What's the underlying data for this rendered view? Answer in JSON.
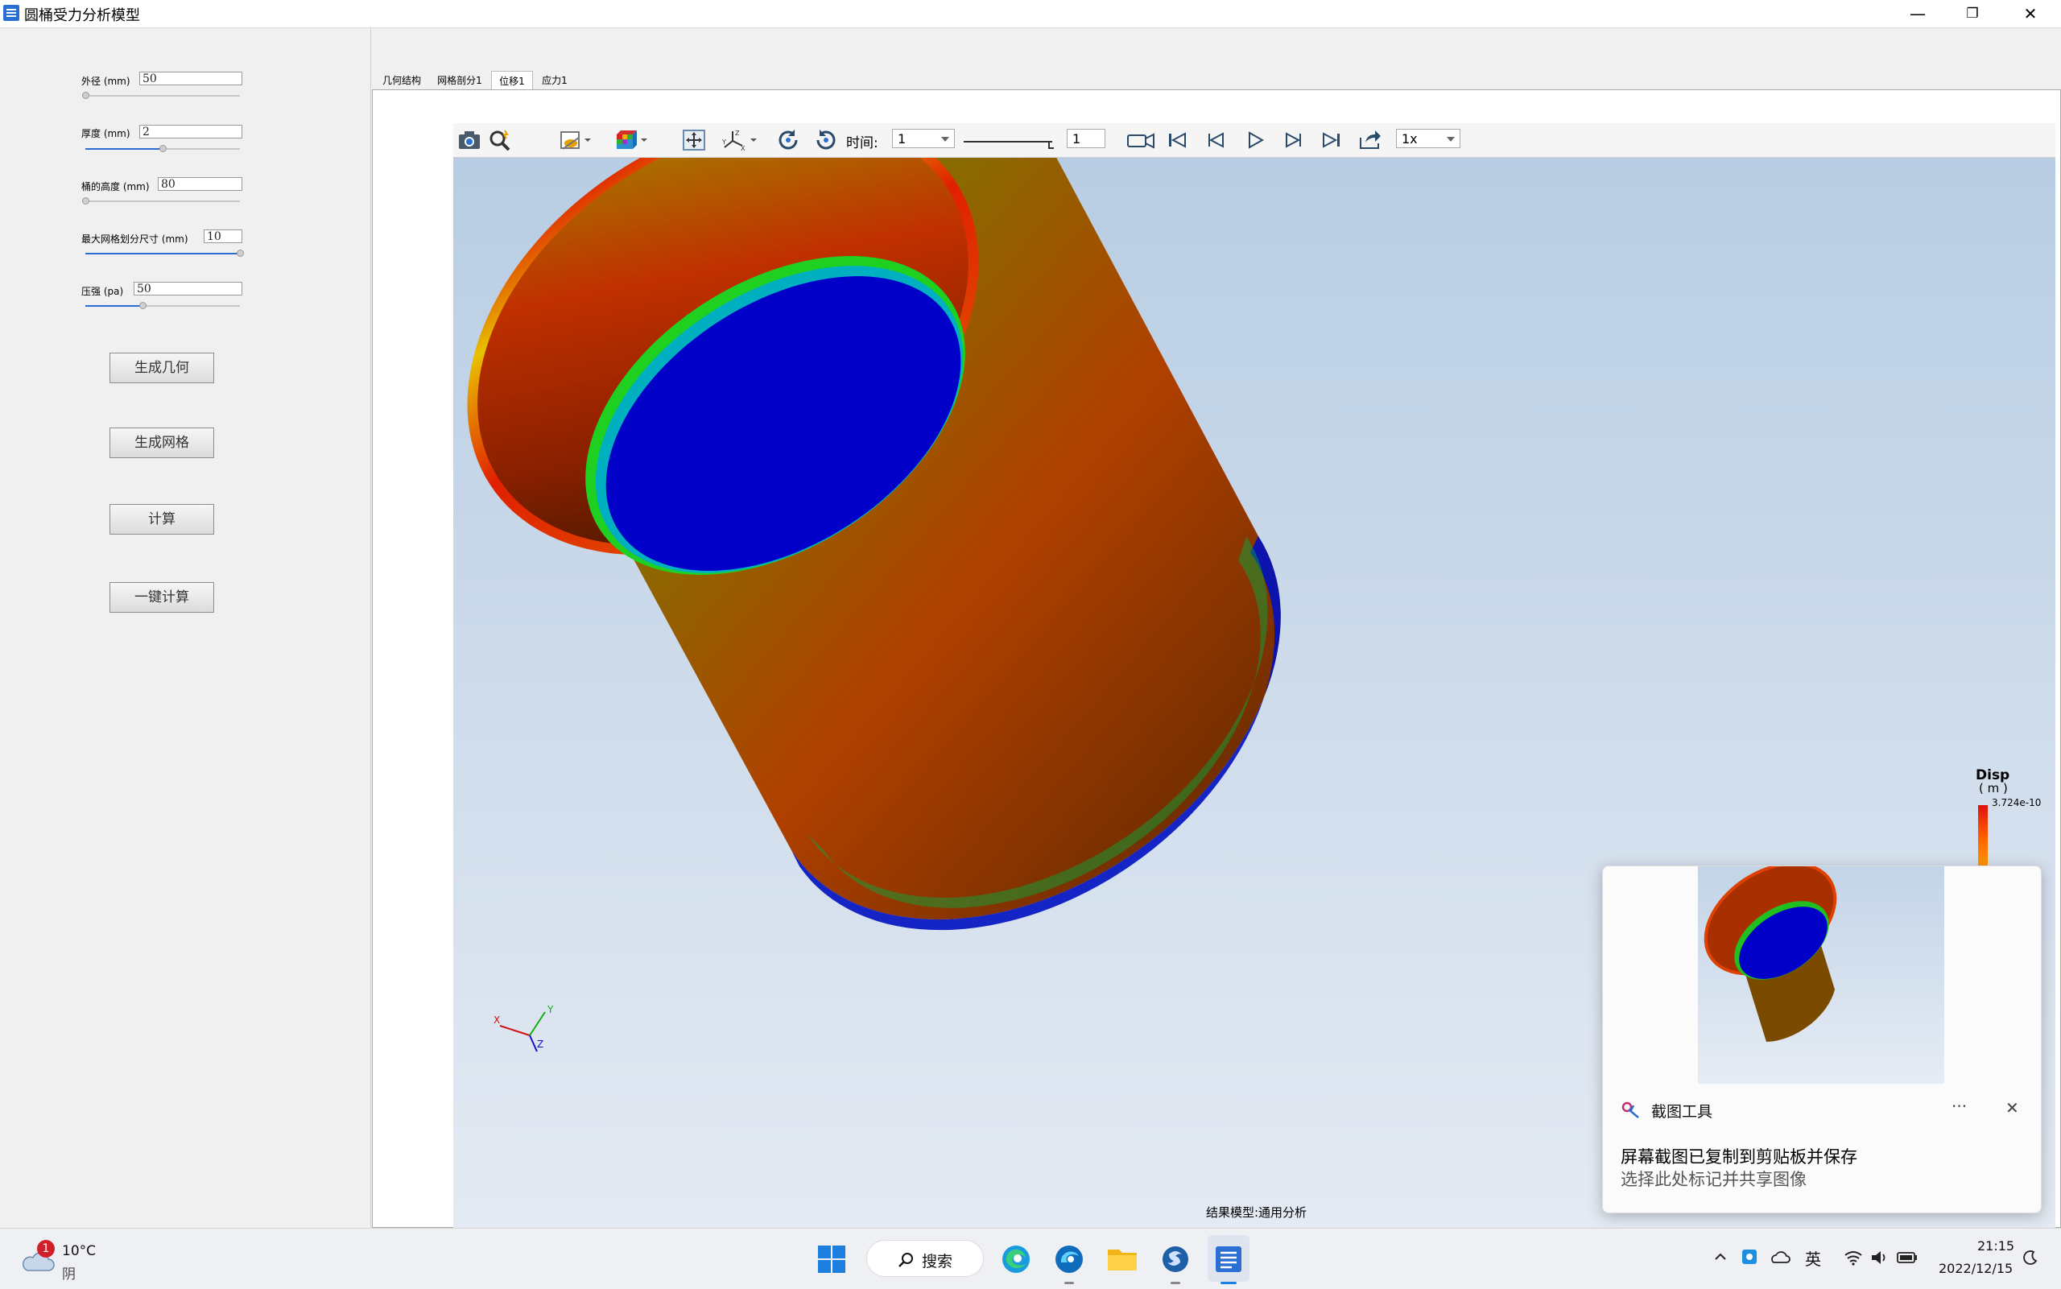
{
  "window": {
    "title": "圆桶受力分析模型",
    "minimize": "—",
    "restore": "❐",
    "close": "✕"
  },
  "params": {
    "outer_diameter": {
      "label": "外径 (mm)",
      "value": "50",
      "slider_fraction": 0.0
    },
    "thickness": {
      "label": "厚度 (mm)",
      "value": "2",
      "slider_fraction": 0.5
    },
    "height": {
      "label": "桶的高度 (mm)",
      "value": "80",
      "slider_fraction": 0.0
    },
    "max_mesh_size": {
      "label": "最大网格划分尺寸 (mm)",
      "value": "10",
      "slider_fraction": 1.0
    },
    "pressure": {
      "label": "压强 (pa)",
      "value": "50",
      "slider_fraction": 0.37
    }
  },
  "buttons": {
    "gen_geometry": "生成几何",
    "gen_mesh": "生成网格",
    "compute": "计算",
    "one_click": "一键计算"
  },
  "tabs": [
    {
      "label": "几何结构",
      "active": false
    },
    {
      "label": "网格剖分1",
      "active": false
    },
    {
      "label": "位移1",
      "active": true
    },
    {
      "label": "应力1",
      "active": false
    }
  ],
  "toolbar": {
    "time_label": "时间:",
    "time_value": "1",
    "step_value": "1",
    "speed_value": "1x"
  },
  "viewport": {
    "status": "结果模型:通用分析",
    "axis_x": "X",
    "axis_y": "Y",
    "axis_z": "Z",
    "legend_title": "Disp",
    "legend_unit": "( m )",
    "legend_max": "3.724e-10"
  },
  "notification": {
    "app": "截图工具",
    "more": "···",
    "close": "✕",
    "headline": "屏幕截图已复制到剪贴板并保存",
    "body": "选择此处标记并共享图像"
  },
  "taskbar": {
    "weather_badge": "1",
    "temperature": "10°C",
    "condition": "阴",
    "search": "搜索",
    "ime": "英",
    "time": "21:15",
    "date": "2022/12/15"
  },
  "colors": {
    "accent": "#2a6fd1",
    "result_high": "#e01010",
    "result_low": "#0000c8"
  }
}
